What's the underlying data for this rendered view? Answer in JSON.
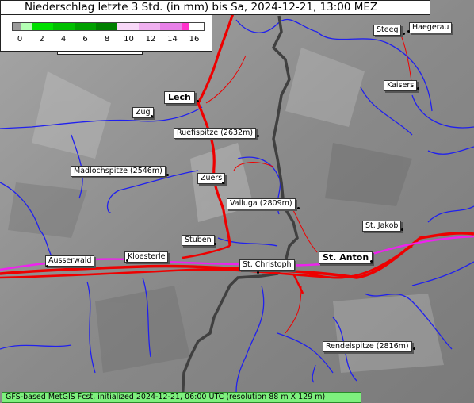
{
  "title": "Niederschlag letzte 3 Std. (in mm) bis Sa, 2024-12-21, 13:00 MEZ",
  "legend": {
    "ticks": [
      "0",
      "2",
      "4",
      "6",
      "8",
      "10",
      "12",
      "14",
      "16"
    ],
    "colors": [
      "#9a9a9a",
      "#b4ffb4",
      "#00e000",
      "#00c000",
      "#00a000",
      "#008000",
      "#f8d8f8",
      "#f0b0f0",
      "#e880e8",
      "#ff33cc"
    ]
  },
  "places": [
    {
      "id": "steeg",
      "name": "Steeg"
    },
    {
      "id": "haegerau",
      "name": "Haegerau"
    },
    {
      "id": "kaisers",
      "name": "Kaisers"
    },
    {
      "id": "lech",
      "name": "Lech"
    },
    {
      "id": "zug",
      "name": "Zug"
    },
    {
      "id": "ruefispitze",
      "name": "Ruefispitze (2632m)"
    },
    {
      "id": "madlochspitze",
      "name": "Madlochspitze (2546m)"
    },
    {
      "id": "zuers",
      "name": "Zuers"
    },
    {
      "id": "valluga",
      "name": "Valluga (2809m)"
    },
    {
      "id": "st-jakob",
      "name": "St. Jakob"
    },
    {
      "id": "stuben",
      "name": "Stuben"
    },
    {
      "id": "ausserwald",
      "name": "Ausserwald"
    },
    {
      "id": "kloesterle",
      "name": "Kloesterle"
    },
    {
      "id": "st-christoph",
      "name": "St. Christoph"
    },
    {
      "id": "st-anton",
      "name": "St. Anton"
    },
    {
      "id": "rendelspitze",
      "name": "Rendelspitze (2816m)"
    }
  ],
  "footer": "GFS-based MetGIS Fcst, initialized 2024-12-21, 06:00 UTC  (resolution 88 m X 129 m)",
  "map_colors": {
    "terrain": "#8f8f8f",
    "rivers": "#2020ee",
    "roads": "#ee0000",
    "border": "#404040",
    "rail": "#ee22ee"
  }
}
